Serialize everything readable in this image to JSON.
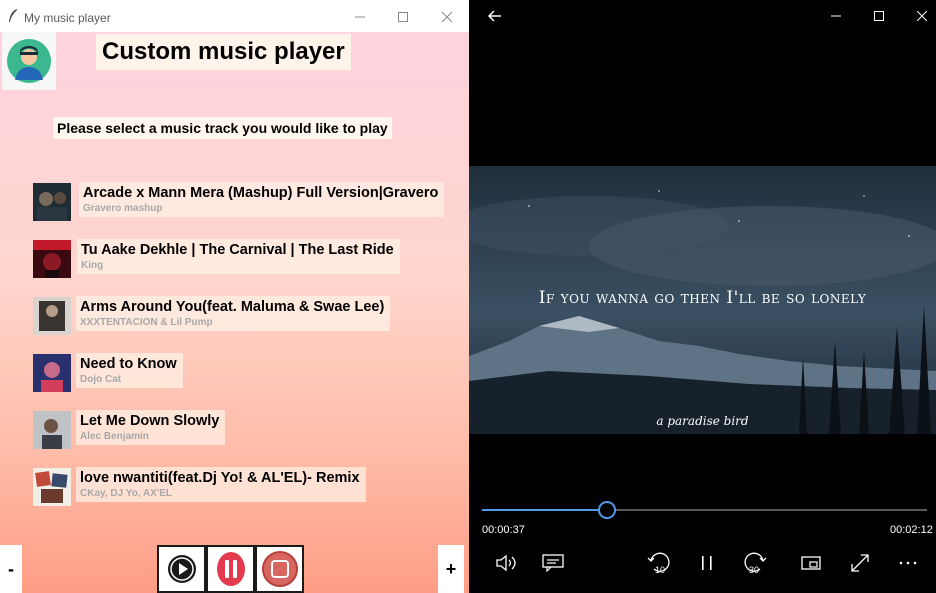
{
  "left_window": {
    "title": "My music player",
    "app_title": "Custom music player",
    "prompt": "Please select a music track you would like to play",
    "tracks": [
      {
        "title": "Arcade x Mann Mera (Mashup) Full Version|Gravero",
        "artist": "Gravero mashup"
      },
      {
        "title": "Tu Aake Dekhle | The Carnival | The Last Ride",
        "artist": "King"
      },
      {
        "title": "Arms Around You(feat. Maluma & Swae Lee)",
        "artist": "XXXTENTACION & Lil Pump"
      },
      {
        "title": "Need to Know",
        "artist": "Dojo Cat"
      },
      {
        "title": "Let Me Down Slowly",
        "artist": "Alec Benjamin"
      },
      {
        "title": "love nwantiti(feat.Dj Yo! & AL'EL)- Remix",
        "artist": "CKay, DJ Yo, AX'EL"
      }
    ],
    "volume_down_label": "-",
    "volume_up_label": "+",
    "controls": [
      "play-icon",
      "pause-icon",
      "stop-icon"
    ]
  },
  "media_player": {
    "lyric": "If you wanna go then I'll be so lonely",
    "credit": "a paradise bird",
    "elapsed": "00:00:37",
    "total": "00:02:12",
    "progress": 0.28,
    "skip_back_label": "10",
    "skip_forward_label": "30",
    "accent": "#4f9bea"
  }
}
